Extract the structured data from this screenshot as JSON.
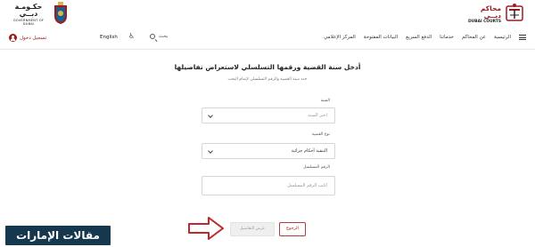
{
  "logos": {
    "gov_ar": "حكـومـة دبــي",
    "gov_en": "GOVERNMENT OF DUBAI",
    "courts_ar": "محاكم دبــي",
    "courts_en": "DUBAI COURTS"
  },
  "header": {
    "login_label": "تسجيل دخول",
    "language_label": "English",
    "search_placeholder": "بحث",
    "nav": [
      "الرئيسية",
      "عن المحاكم",
      "خدماتنا",
      "الدفع السريع",
      "البيانات المفتوحة",
      "المركز الإعلامي"
    ]
  },
  "form": {
    "title": "أدخل سنة القضية ورقمها التسلسلي لاستعراض تفاصيلها",
    "subtitle": "حدد سنة القضية والرقم التسلسلي لإتمام البحث",
    "year_label": "السنة",
    "year_placeholder": "اختر السنة",
    "case_type_label": "نوع القضية",
    "case_type_value": "التنفيذ أحكام جزائية",
    "serial_label": "الرقم المسلسل",
    "serial_placeholder": "اكتب الرقم المسلسل"
  },
  "buttons": {
    "view_label": "عرض التفاصيل",
    "back_label": "الرجوع"
  },
  "watermark": "مقالات الإمارات",
  "colors": {
    "brand": "#9b1b20",
    "arrow": "#c0282d",
    "watermark_bg": "#15384f"
  }
}
